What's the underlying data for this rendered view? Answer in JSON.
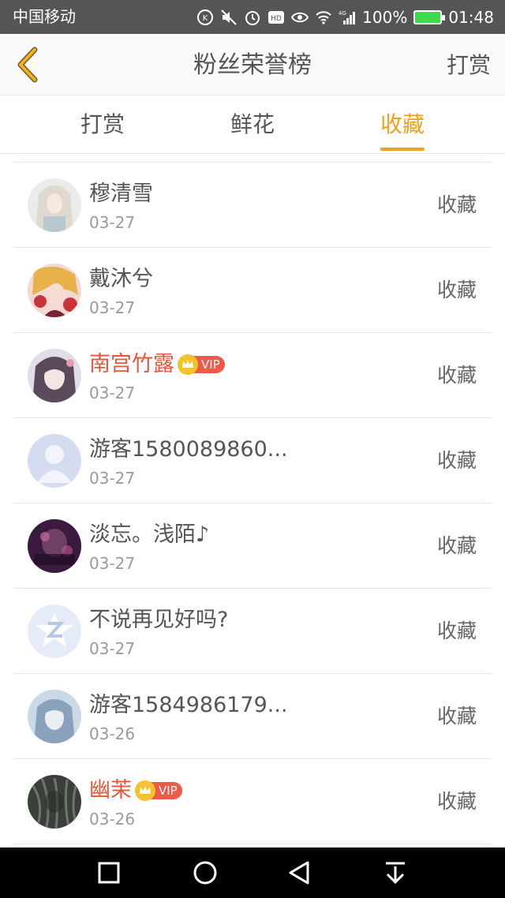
{
  "status_bar": {
    "carrier": "中国移动",
    "battery": "100%",
    "time": "01:48",
    "icons": [
      "data-speed-icon",
      "mute-icon",
      "alarm-icon",
      "hd-icon",
      "eye-icon",
      "wifi-icon",
      "signal-icon",
      "battery-icon"
    ],
    "network_label": "4G"
  },
  "header": {
    "title": "粉丝荣誉榜",
    "right_link": "打赏",
    "back_icon": "chevron-left-icon",
    "back_color": "#f0b020"
  },
  "tabs": [
    {
      "label": "打赏",
      "active": false
    },
    {
      "label": "鲜花",
      "active": false
    },
    {
      "label": "收藏",
      "active": true
    }
  ],
  "accent_color": "#f0a020",
  "vip_label": "VIP",
  "fans": [
    {
      "name": "穆清雪",
      "date": "03-27",
      "action": "收藏",
      "vip": false
    },
    {
      "name": "戴沐兮",
      "date": "03-27",
      "action": "收藏",
      "vip": false
    },
    {
      "name": "南宫竹露",
      "date": "03-27",
      "action": "收藏",
      "vip": true
    },
    {
      "name": "游客1580089860...",
      "date": "03-27",
      "action": "收藏",
      "vip": false
    },
    {
      "name": "淡忘。浅陌♪",
      "date": "03-27",
      "action": "收藏",
      "vip": false
    },
    {
      "name": "不说再见好吗?",
      "date": "03-27",
      "action": "收藏",
      "vip": false
    },
    {
      "name": "游客1584986179...",
      "date": "03-26",
      "action": "收藏",
      "vip": false
    },
    {
      "name": "幽茉",
      "date": "03-26",
      "action": "收藏",
      "vip": true
    }
  ],
  "nav_bar": {
    "icons": [
      "square-icon",
      "circle-home-icon",
      "triangle-back-icon",
      "pull-down-icon"
    ]
  }
}
